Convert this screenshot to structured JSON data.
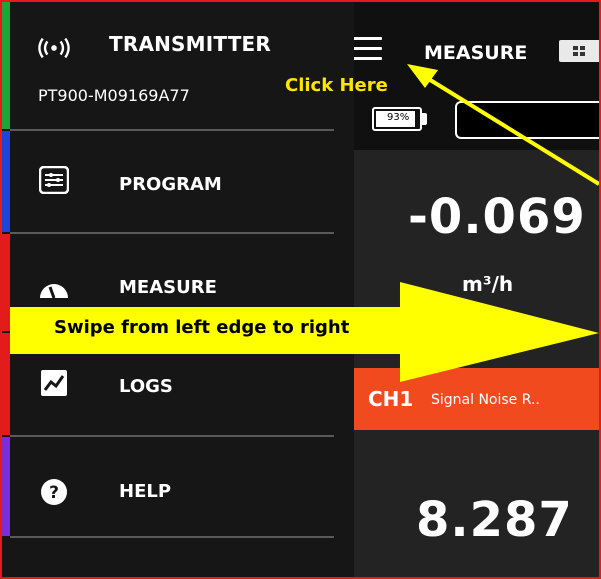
{
  "header": {
    "transmitter_title": "TRANSMITTER",
    "serial": "PT900-M09169A77",
    "measure_title": "MEASURE",
    "battery_percent": "93%"
  },
  "sidebar": {
    "items": [
      {
        "label": "PROGRAM",
        "icon": "program-icon"
      },
      {
        "label": "MEASURE",
        "icon": "gauge-icon"
      },
      {
        "label": "LOGS",
        "icon": "logs-chart-icon"
      },
      {
        "label": "HELP",
        "icon": "help-icon"
      }
    ],
    "strip_colors": [
      "#1fa43a",
      "#1f45d6",
      "#e21b1b",
      "#e21b1b",
      "#7a2fd6"
    ]
  },
  "main": {
    "reading1_value": "-0.069",
    "reading1_unit": "m³/h",
    "channel_label": "CH1",
    "channel_desc": "Signal Noise R..",
    "reading2_value": "8.287"
  },
  "annotations": {
    "click_here": "Click Here",
    "swipe_text": "Swipe from left edge to right",
    "arrow_color": "#ffff00"
  },
  "colors": {
    "frame_border": "#e21b1b",
    "channel_bar": "#f04a1e",
    "annotation_yellow": "#ffe400"
  }
}
